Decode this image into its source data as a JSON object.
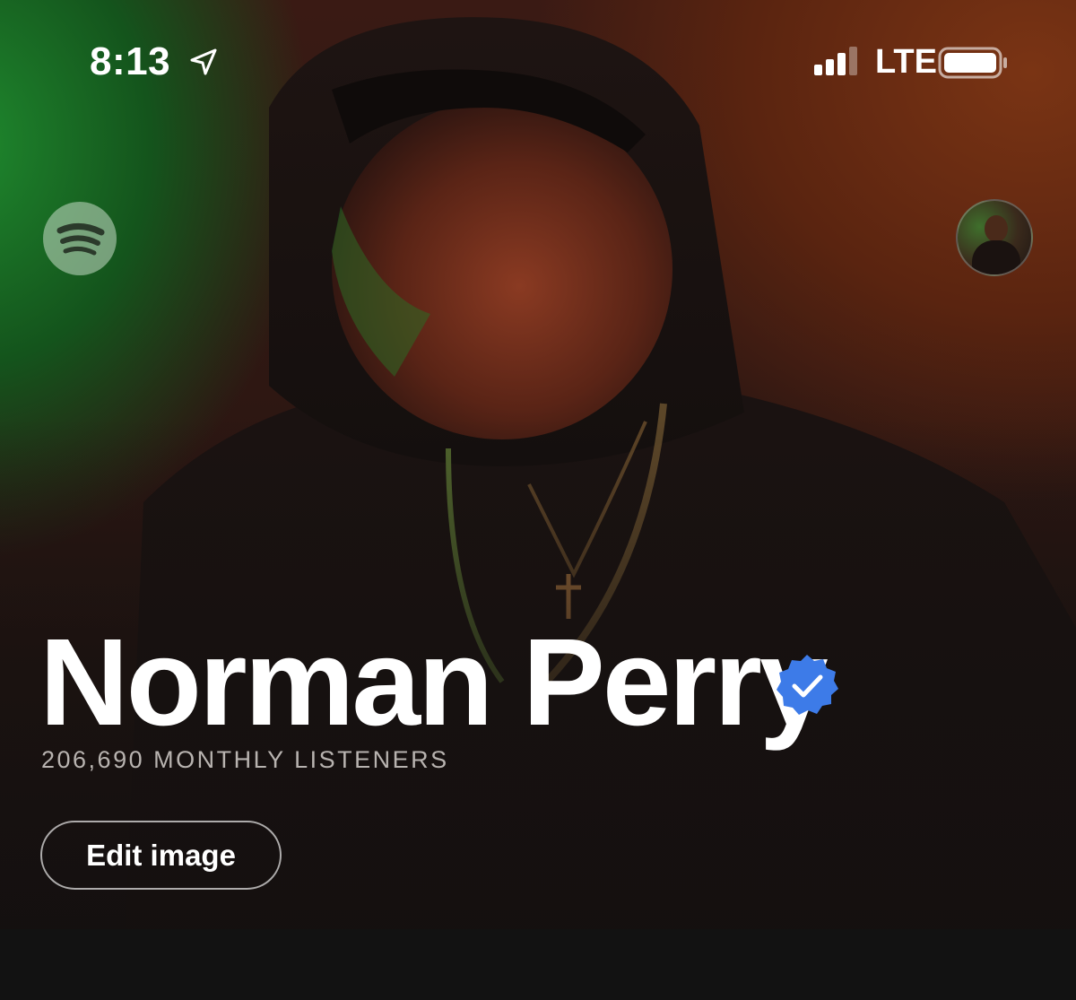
{
  "status_bar": {
    "time": "8:13",
    "network": "LTE",
    "icons": [
      "location-arrow-icon",
      "signal-bars-icon",
      "battery-icon"
    ]
  },
  "header": {
    "logo_icon": "spotify-icon",
    "avatar": "profile-avatar"
  },
  "artist": {
    "name": "Norman Perry",
    "verified": true,
    "verified_icon": "verified-badge-icon",
    "listeners": "206,690 MONTHLY LISTENERS",
    "edit_label": "Edit image"
  },
  "colors": {
    "background": "#121212",
    "verified_badge": "#3d7be8",
    "text_primary": "#ffffff",
    "text_secondary": "#b8b3b0"
  }
}
